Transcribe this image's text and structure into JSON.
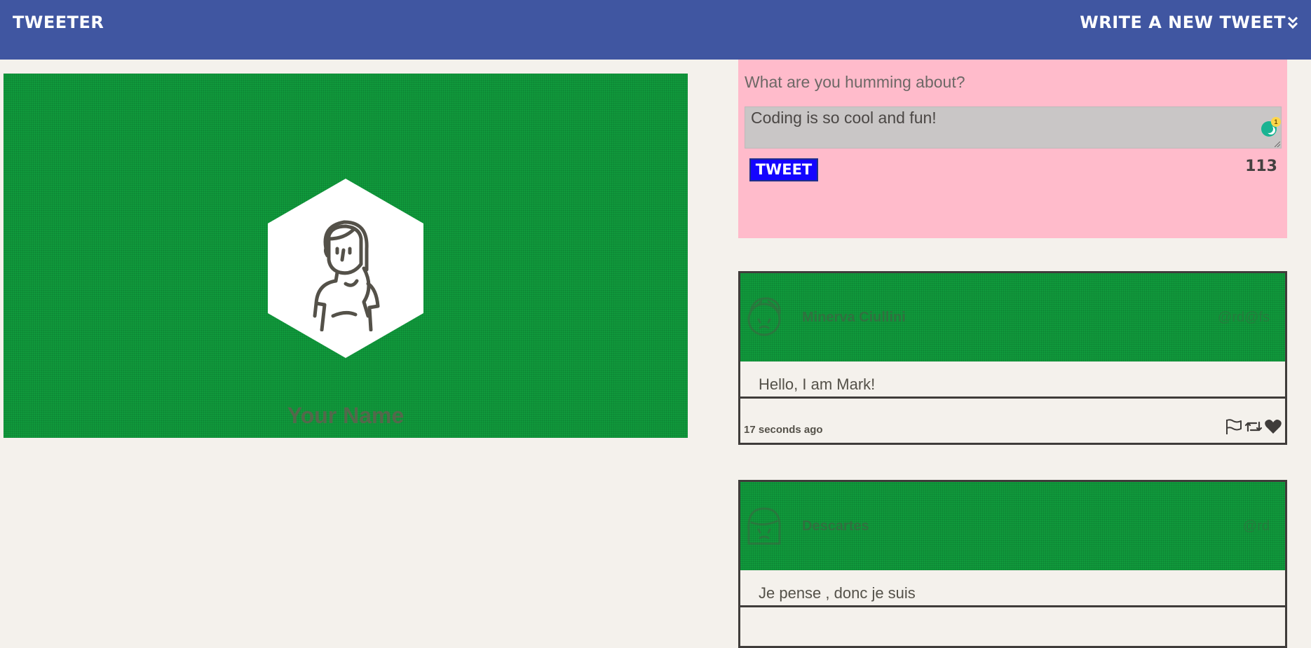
{
  "nav": {
    "brand": "TWEETER",
    "write_label": "WRITE A NEW TWEET"
  },
  "profile": {
    "name": "Your Name"
  },
  "compose": {
    "label": "What are you humming about?",
    "text": "Coding is so cool and fun!",
    "tweet_button": "TWEET",
    "char_counter": "113",
    "grammar_badge": "1"
  },
  "tweets": [
    {
      "author": "Minerva Ciullini",
      "handle": "@rd@fs",
      "text": "Hello, I am Mark!",
      "time": "17 seconds ago"
    },
    {
      "author": "Descartes",
      "handle": "@rd",
      "text": "Je pense , donc je suis"
    }
  ],
  "icons": {
    "flag": "flag-icon",
    "retweet": "retweet-icon",
    "like": "heart-icon",
    "chevron": "double-chevron-down-icon"
  },
  "colors": {
    "nav": "#4056a1",
    "page_bg": "#f4f1ec",
    "banner_green": "#109a3c",
    "compose_bg": "#ffbbcb",
    "tweet_button": "#1405ff"
  }
}
